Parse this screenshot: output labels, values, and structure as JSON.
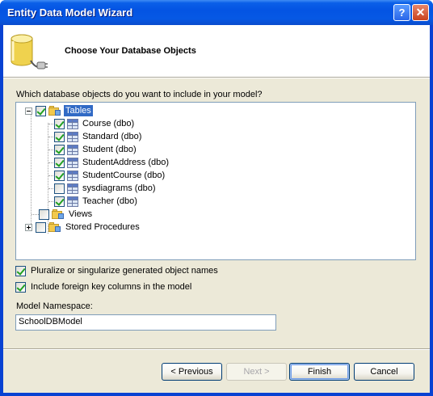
{
  "window": {
    "title": "Entity Data Model Wizard",
    "help_symbol": "?",
    "close_symbol": "✕"
  },
  "header": {
    "title": "Choose Your Database Objects",
    "icon": "database-connect-icon"
  },
  "question": "Which database objects do you want to include in your model?",
  "tree": {
    "tables": {
      "label": "Tables",
      "checked": true,
      "expanded": true,
      "items": [
        {
          "label": "Course (dbo)",
          "checked": true
        },
        {
          "label": "Standard (dbo)",
          "checked": true
        },
        {
          "label": "Student (dbo)",
          "checked": true
        },
        {
          "label": "StudentAddress (dbo)",
          "checked": true
        },
        {
          "label": "StudentCourse (dbo)",
          "checked": true
        },
        {
          "label": "sysdiagrams (dbo)",
          "checked": false
        },
        {
          "label": "Teacher (dbo)",
          "checked": true
        }
      ]
    },
    "views": {
      "label": "Views",
      "checked": false
    },
    "stored_procedures": {
      "label": "Stored Procedures",
      "checked": false,
      "expanded": false
    }
  },
  "options": {
    "pluralize": {
      "label": "Pluralize or singularize generated object names",
      "checked": true
    },
    "foreign_keys": {
      "label": "Include foreign key columns in the model",
      "checked": true
    }
  },
  "namespace": {
    "label": "Model Namespace:",
    "value": "SchoolDBModel"
  },
  "buttons": {
    "previous": "< Previous",
    "next": "Next >",
    "finish": "Finish",
    "cancel": "Cancel"
  }
}
